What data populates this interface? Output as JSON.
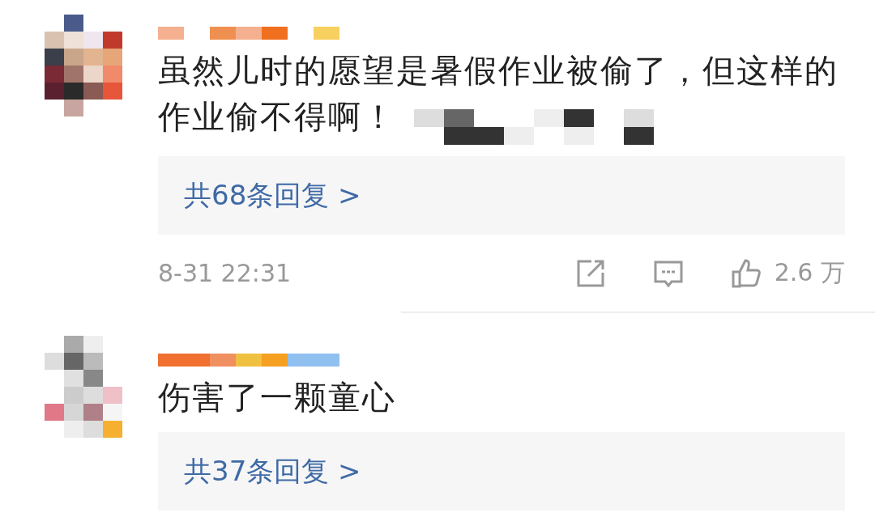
{
  "comments": [
    {
      "lines": [
        "虽然儿时的愿望是暑假作业被偷了，但这样的",
        "作业偷不得啊！"
      ],
      "replies": "共68条回复 >",
      "time": "8-31 22:31",
      "likes": "2.6 万"
    },
    {
      "lines": [
        "伤害了一颗童心"
      ],
      "replies": "共37条回复 >"
    }
  ]
}
